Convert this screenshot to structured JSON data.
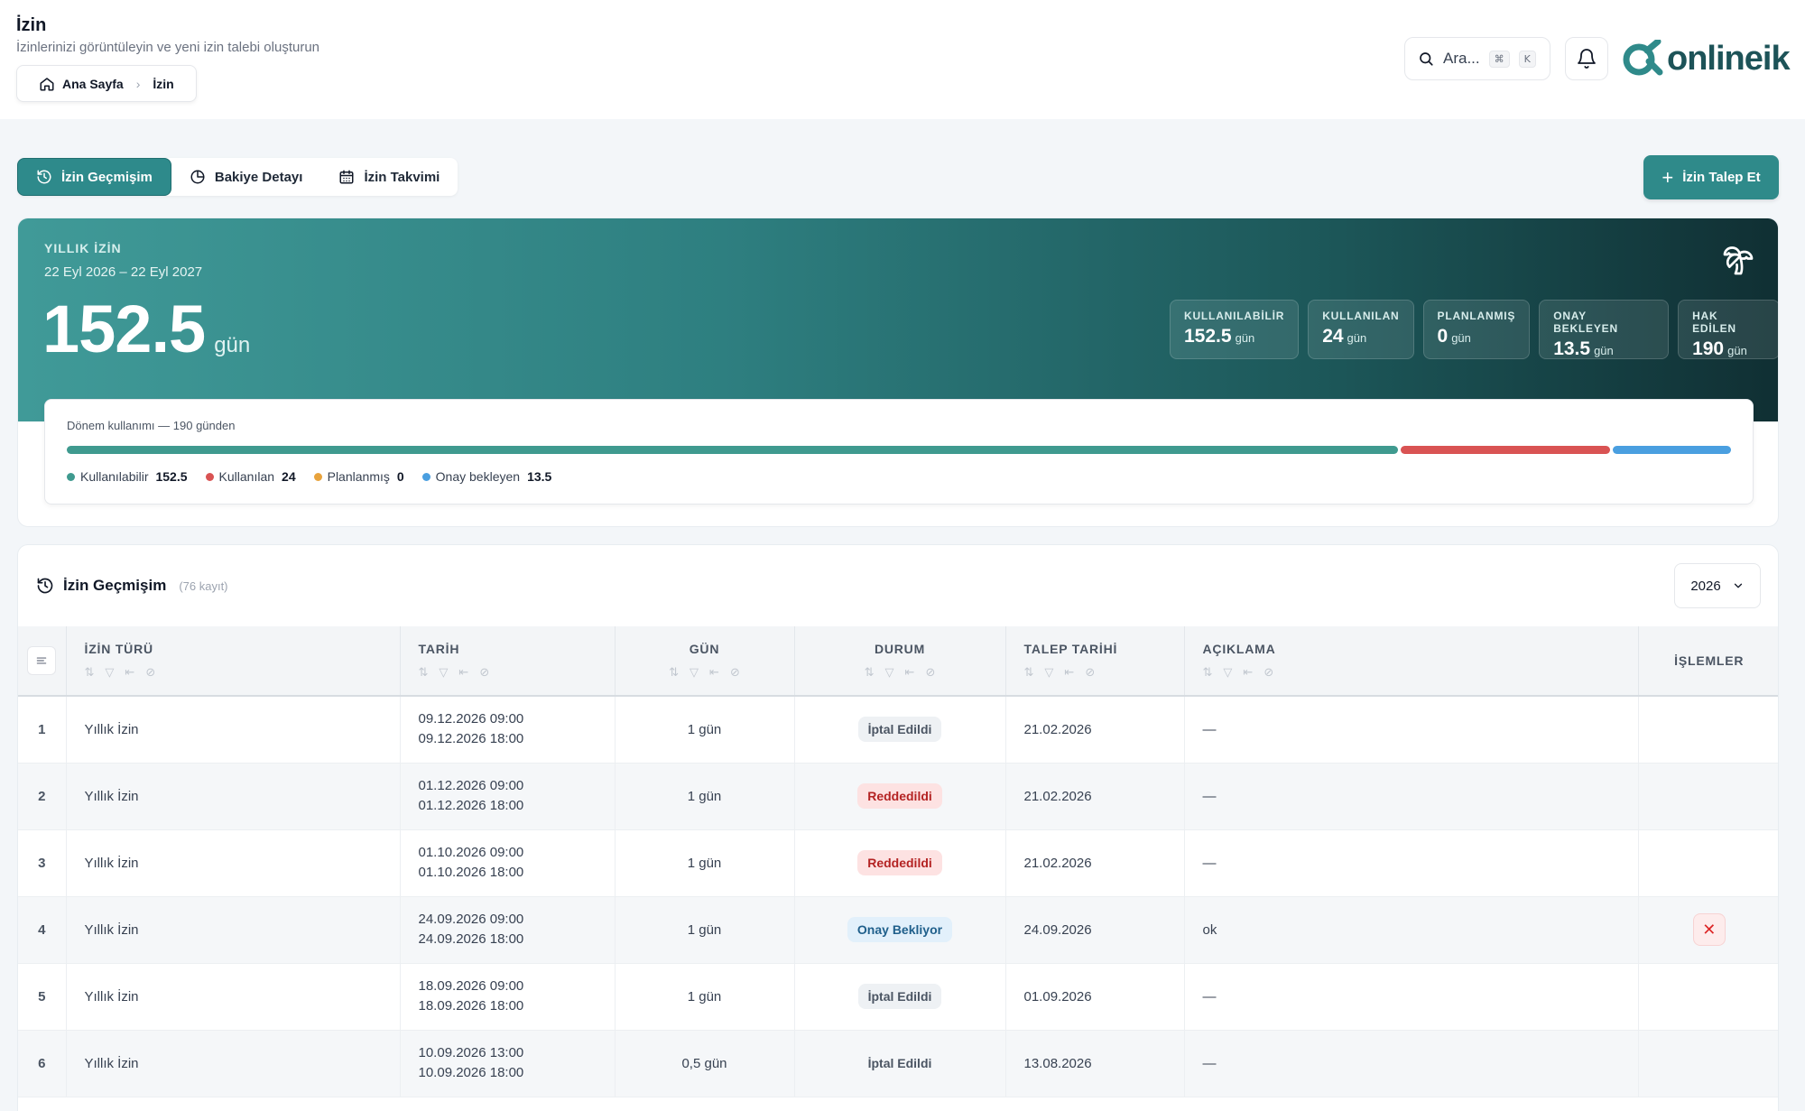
{
  "header": {
    "title": "İzin",
    "subtitle": "İzinlerinizi görüntüleyin ve yeni izin talebi oluşturun",
    "breadcrumb": [
      {
        "label": "Ana Sayfa"
      },
      {
        "label": "İzin"
      }
    ],
    "search_placeholder": "Ara...",
    "search_shortcut_cmd": "⌘",
    "search_shortcut_key": "K",
    "logo_text": "onlineik",
    "brand_color": "#2f8a8a"
  },
  "tabs": [
    {
      "label": "İzin Geçmişim",
      "icon": "history-icon",
      "active": true
    },
    {
      "label": "Bakiye Detayı",
      "icon": "pie-chart-icon",
      "active": false
    },
    {
      "label": "İzin Takvimi",
      "icon": "calendar-icon",
      "active": false
    }
  ],
  "request_button": "İzin Talep Et",
  "hero": {
    "kicker": "YILLIK İZİN",
    "range": "22 Eyl 2026 – 22 Eyl 2027",
    "value": "152.5",
    "unit": "gün",
    "stats": [
      {
        "label": "KULLANILABİLİR",
        "value": "152.5",
        "unit": "gün"
      },
      {
        "label": "KULLANILAN",
        "value": "24",
        "unit": "gün"
      },
      {
        "label": "PLANLANMIŞ",
        "value": "0",
        "unit": "gün"
      },
      {
        "label": "ONAY BEKLEYEN",
        "value": "13.5",
        "unit": "gün"
      },
      {
        "label": "HAK EDİLEN",
        "value": "190",
        "unit": "gün"
      }
    ]
  },
  "usage": {
    "title": "Dönem kullanımı — 190 günden",
    "total": 190,
    "segments": [
      {
        "label": "Kullanılabilir",
        "value": 152.5,
        "color": "#3f9a8f"
      },
      {
        "label": "Kullanılan",
        "value": 24,
        "color": "#d95353"
      },
      {
        "label": "Planlanmış",
        "value": 0,
        "color": "#e8a33d"
      },
      {
        "label": "Onay bekleyen",
        "value": 13.5,
        "color": "#4a9fe0"
      }
    ],
    "legend": [
      {
        "label": "Kullanılabilir",
        "value": "152.5",
        "color": "#3f9a8f"
      },
      {
        "label": "Kullanılan",
        "value": "24",
        "color": "#d95353"
      },
      {
        "label": "Planlanmış",
        "value": "0",
        "color": "#e8a33d"
      },
      {
        "label": "Onay bekleyen",
        "value": "13.5",
        "color": "#4a9fe0"
      }
    ]
  },
  "history": {
    "title": "İzin Geçmişim",
    "count": "(76 kayıt)",
    "year": "2026",
    "columns": {
      "type": "İZİN TÜRÜ",
      "date": "TARİH",
      "days": "GÜN",
      "status": "DURUM",
      "request_date": "TALEP TARİHİ",
      "note": "AÇIKLAMA",
      "actions": "İŞLEMLER"
    },
    "rows": [
      {
        "no": "1",
        "type": "Yıllık İzin",
        "start": "09.12.2026 09:00",
        "end": "09.12.2026 18:00",
        "days": "1 gün",
        "status": "İptal Edildi",
        "status_kind": "cancelled",
        "request_date": "21.02.2026",
        "note": "—",
        "can_cancel": false
      },
      {
        "no": "2",
        "type": "Yıllık İzin",
        "start": "01.12.2026 09:00",
        "end": "01.12.2026 18:00",
        "days": "1 gün",
        "status": "Reddedildi",
        "status_kind": "rejected",
        "request_date": "21.02.2026",
        "note": "—",
        "can_cancel": false
      },
      {
        "no": "3",
        "type": "Yıllık İzin",
        "start": "01.10.2026 09:00",
        "end": "01.10.2026 18:00",
        "days": "1 gün",
        "status": "Reddedildi",
        "status_kind": "rejected",
        "request_date": "21.02.2026",
        "note": "—",
        "can_cancel": false
      },
      {
        "no": "4",
        "type": "Yıllık İzin",
        "start": "24.09.2026 09:00",
        "end": "24.09.2026 18:00",
        "days": "1 gün",
        "status": "Onay Bekliyor",
        "status_kind": "pending",
        "request_date": "24.09.2026",
        "note": "ok",
        "can_cancel": true
      },
      {
        "no": "5",
        "type": "Yıllık İzin",
        "start": "18.09.2026 09:00",
        "end": "18.09.2026 18:00",
        "days": "1 gün",
        "status": "İptal Edildi",
        "status_kind": "cancelled",
        "request_date": "01.09.2026",
        "note": "—",
        "can_cancel": false
      },
      {
        "no": "6",
        "type": "Yıllık İzin",
        "start": "10.09.2026 13:00",
        "end": "10.09.2026 18:00",
        "days": "0,5 gün",
        "status": "İptal Edildi",
        "status_kind": "plain",
        "request_date": "13.08.2026",
        "note": "—",
        "can_cancel": false
      }
    ]
  }
}
